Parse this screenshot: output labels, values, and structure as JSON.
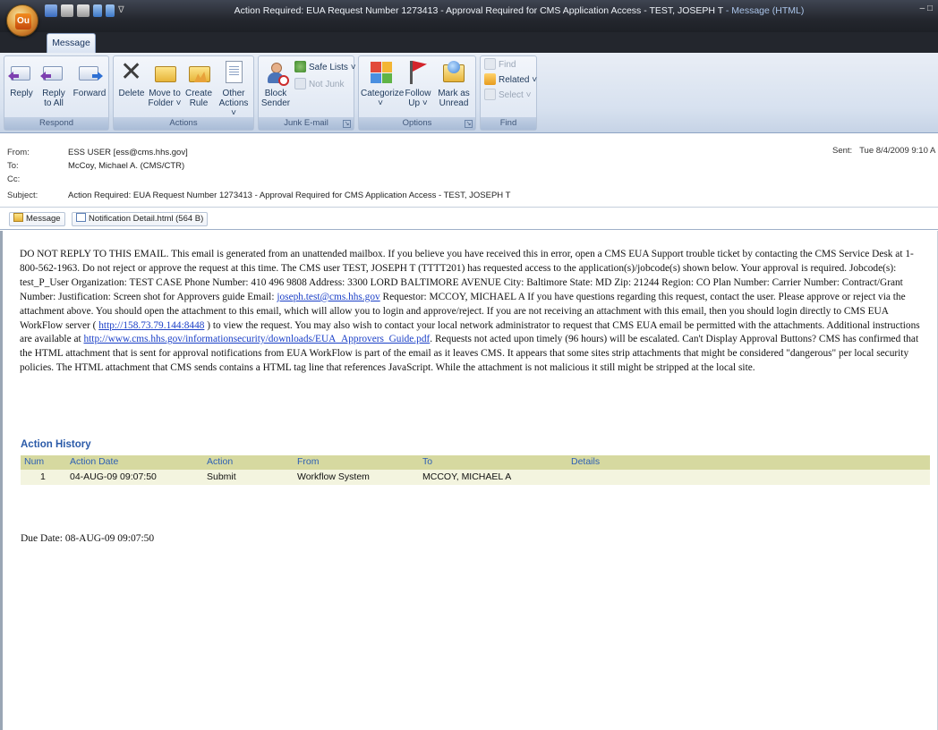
{
  "window": {
    "title_main": "Action Required: EUA Request Number 1273413 - Approval Required for CMS Application Access - TEST, JOSEPH T",
    "title_app": " - Message (HTML)",
    "app_logo": "Ou"
  },
  "tabs": {
    "message": "Message"
  },
  "ribbon": {
    "respond": {
      "label": "Respond",
      "reply": "Reply",
      "reply_all_1": "Reply",
      "reply_all_2": "to All",
      "forward": "Forward"
    },
    "actions": {
      "label": "Actions",
      "delete": "Delete",
      "move_1": "Move to",
      "move_2": "Folder ˅",
      "create_1": "Create",
      "create_2": "Rule",
      "other_1": "Other",
      "other_2": "Actions ˅"
    },
    "junk": {
      "label": "Junk E-mail",
      "block_1": "Block",
      "block_2": "Sender",
      "safe_lists": "Safe Lists ˅",
      "not_junk": "Not Junk"
    },
    "options": {
      "label": "Options",
      "categorize": "Categorize",
      "follow_1": "Follow",
      "follow_2": "Up ˅",
      "mark_1": "Mark as",
      "mark_2": "Unread"
    },
    "find": {
      "label": "Find",
      "find": "Find",
      "related": "Related ˅",
      "select": "Select ˅"
    }
  },
  "header": {
    "from_label": "From:",
    "from_value": "ESS USER [ess@cms.hhs.gov]",
    "to_label": "To:",
    "to_value": "McCoy, Michael A. (CMS/CTR)",
    "cc_label": "Cc:",
    "subject_label": "Subject:",
    "subject_value": "Action Required: EUA Request Number 1273413 - Approval Required for CMS Application Access - TEST, JOSEPH T",
    "sent_label": "Sent:",
    "sent_value": "Tue 8/4/2009 9:10 A"
  },
  "attachments": {
    "message": "Message",
    "file": "Notification Detail.html (564 B)"
  },
  "body": {
    "p1": "DO NOT REPLY TO THIS EMAIL. This email is generated from an unattended mailbox. If you believe you have received this in error, open a CMS EUA Support trouble ticket by contacting the CMS Service Desk at 1-800-562-1963. Do not reject or approve the request at this time. The CMS user TEST, JOSEPH T (TTTT201) has requested access to the application(s)/jobcode(s) shown below. Your approval is required. Jobcode(s): test_P_User Organization: TEST CASE Phone Number: 410 496 9808 Address: 3300 LORD BALTIMORE AVENUE City: Baltimore State: MD Zip: 21244 Region: CO Plan Number: Carrier Number: Contract/Grant Number: Justification: Screen shot for Approvers guide Email: ",
    "email_link": "joseph.test@cms.hhs.gov",
    "p2": " Requestor: MCCOY, MICHAEL A If you have questions regarding this request, contact the user. Please approve or reject via the attachment above. You should open the attachment to this email, which will allow you to login and approve/reject. If you are not receiving an attachment with this email, then you should login directly to CMS EUA WorkFlow server ( ",
    "server_link": "http://158.73.79.144:8448",
    "p3": " ) to view the request. You may also wish to contact your local network administrator to request that CMS EUA email be permitted with the attachments. Additional instructions are available at ",
    "guide_link": "http://www.cms.hhs.gov/informationsecurity/downloads/EUA_Approvers_Guide.pdf",
    "p4": ". Requests not acted upon timely (96 hours) will be escalated. Can't Display Approval Buttons? CMS has confirmed that the HTML attachment that is sent for approval notifications from EUA WorkFlow is part of the email as it leaves CMS. It appears that some sites strip attachments that might be considered \"dangerous\" per local security policies. The HTML attachment that CMS sends contains a HTML tag line that references JavaScript. While the attachment is not malicious it still might be stripped at the local site.",
    "action_history": "Action History",
    "table": {
      "headers": [
        "Num",
        "Action Date",
        "Action",
        "From",
        "To",
        "Details"
      ],
      "rows": [
        [
          "1",
          "04-AUG-09 09:07:50",
          "Submit",
          "Workflow System",
          "MCCOY, MICHAEL A",
          ""
        ]
      ]
    },
    "due_date": "Due Date: 08-AUG-09 09:07:50"
  },
  "colors": {
    "table_header": "#d6d9a0",
    "table_row": "#f3f4df",
    "link": "#1a3fc7",
    "accent": "#2a5aa8"
  }
}
